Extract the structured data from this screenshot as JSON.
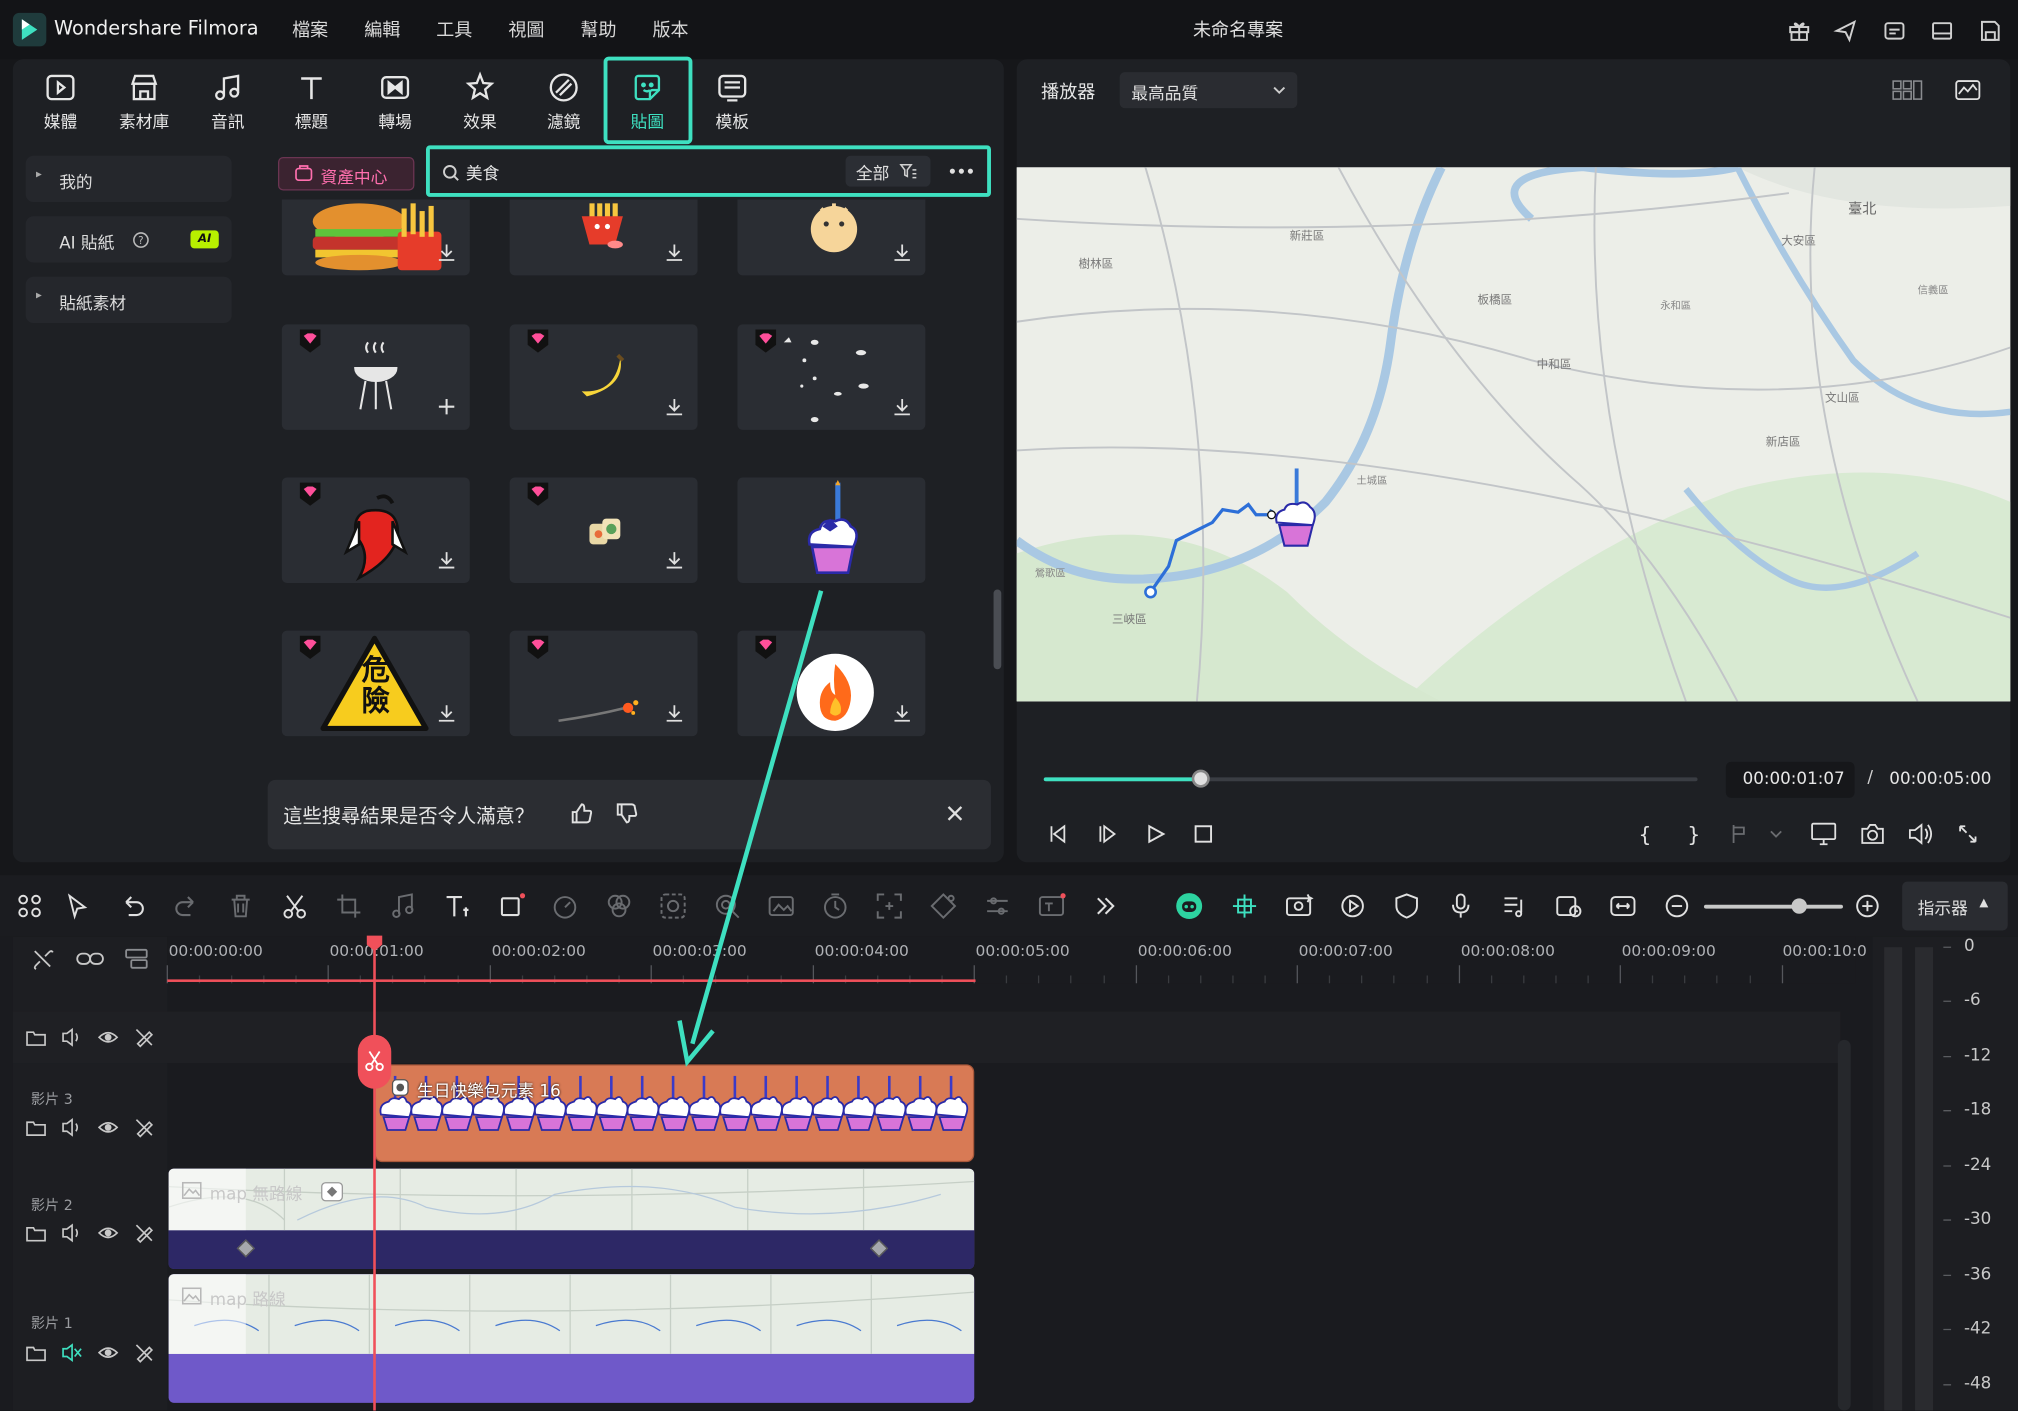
{
  "app": {
    "name": "Wondershare Filmora",
    "project_title": "未命名專案"
  },
  "menu": [
    "檔案",
    "編輯",
    "工具",
    "視圖",
    "幫助",
    "版本"
  ],
  "tool_tabs": [
    {
      "label": "媒體",
      "icon": "media-icon"
    },
    {
      "label": "素材庫",
      "icon": "stock-icon"
    },
    {
      "label": "音訊",
      "icon": "audio-icon"
    },
    {
      "label": "標題",
      "icon": "title-icon"
    },
    {
      "label": "轉場",
      "icon": "transition-icon"
    },
    {
      "label": "效果",
      "icon": "effects-icon"
    },
    {
      "label": "濾鏡",
      "icon": "filter-icon"
    },
    {
      "label": "貼圖",
      "icon": "sticker-icon",
      "active": true
    },
    {
      "label": "模板",
      "icon": "template-icon"
    }
  ],
  "sidebar": {
    "items": [
      {
        "label": "我的"
      },
      {
        "label": "AI 貼紙",
        "badge": "AI"
      },
      {
        "label": "貼紙素材"
      }
    ]
  },
  "library": {
    "asset_center_label": "資產中心",
    "search_value": "美食",
    "filter_label": "全部",
    "stickers": [
      {
        "name": "burger-sticker"
      },
      {
        "name": "fries-sticker"
      },
      {
        "name": "round-creature-sticker"
      },
      {
        "name": "grill-sticker"
      },
      {
        "name": "banana-sticker"
      },
      {
        "name": "particles-sticker"
      },
      {
        "name": "chili-sticker"
      },
      {
        "name": "sushi-sticker"
      },
      {
        "name": "birthday-cupcake-sticker"
      },
      {
        "name": "danger-sign-sticker"
      },
      {
        "name": "spark-sticker"
      },
      {
        "name": "fire-sticker"
      }
    ],
    "danger_text": "危險",
    "feedback_question": "這些搜尋結果是否令人滿意？"
  },
  "player": {
    "label": "播放器",
    "quality": "最高品質",
    "progress": 0.24,
    "current_time": "00:00:01:07",
    "separator": "/",
    "total_time": "00:00:05:00",
    "map_labels": [
      "臺北",
      "大安區",
      "新莊區",
      "板橋區",
      "中和區",
      "文山區",
      "新店區",
      "樹林區",
      "三峽區",
      "土城區",
      "永和區",
      "鶯歌區",
      "信義區"
    ]
  },
  "timeline": {
    "meter_button": "指示器",
    "ruler": [
      "00:00:00:00",
      "00:00:01:00",
      "00:00:02:00",
      "00:00:03:00",
      "00:00:04:00",
      "00:00:05:00",
      "00:00:06:00",
      "00:00:07:00",
      "00:00:08:00",
      "00:00:09:00",
      "00:00:10:0"
    ],
    "meter_scale": [
      "0",
      "-6",
      "-12",
      "-18",
      "-24",
      "-30",
      "-36",
      "-42",
      "-48"
    ],
    "tracks": [
      {
        "name": "影片 3",
        "clip": "生日快樂包元素 16"
      },
      {
        "name": "影片 2",
        "clip": "map 無路線"
      },
      {
        "name": "影片 1",
        "clip": "map 路線"
      }
    ]
  },
  "colors": {
    "accent": "#3ee0c0",
    "playhead": "#f0505a",
    "sticker_clip": "#d87a55",
    "video_clip": "#6f59c9"
  }
}
